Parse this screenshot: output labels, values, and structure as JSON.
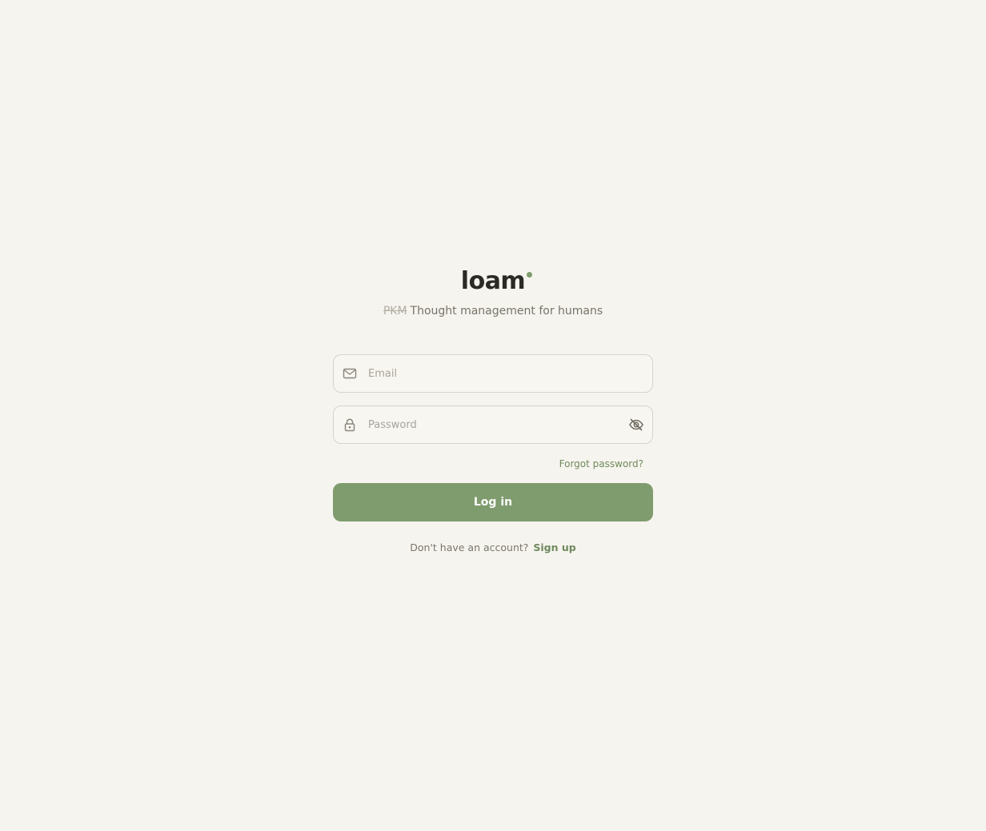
{
  "brand": {
    "name": "loam",
    "tagline_struck": "PKM",
    "tagline": "Thought management for humans"
  },
  "form": {
    "email": {
      "placeholder": "Email",
      "value": "",
      "icon": "mail-icon"
    },
    "password": {
      "placeholder": "Password",
      "value": "",
      "icon": "lock-icon",
      "toggle_icon": "eye-off-icon"
    },
    "forgot_label": "Forgot password?",
    "login_label": "Log in",
    "signup_prompt": "Don't have an account?",
    "signup_label": "Sign up"
  },
  "colors": {
    "background": "#f6f4ee",
    "accent": "#7f9c6e",
    "text": "#2b2a26"
  }
}
